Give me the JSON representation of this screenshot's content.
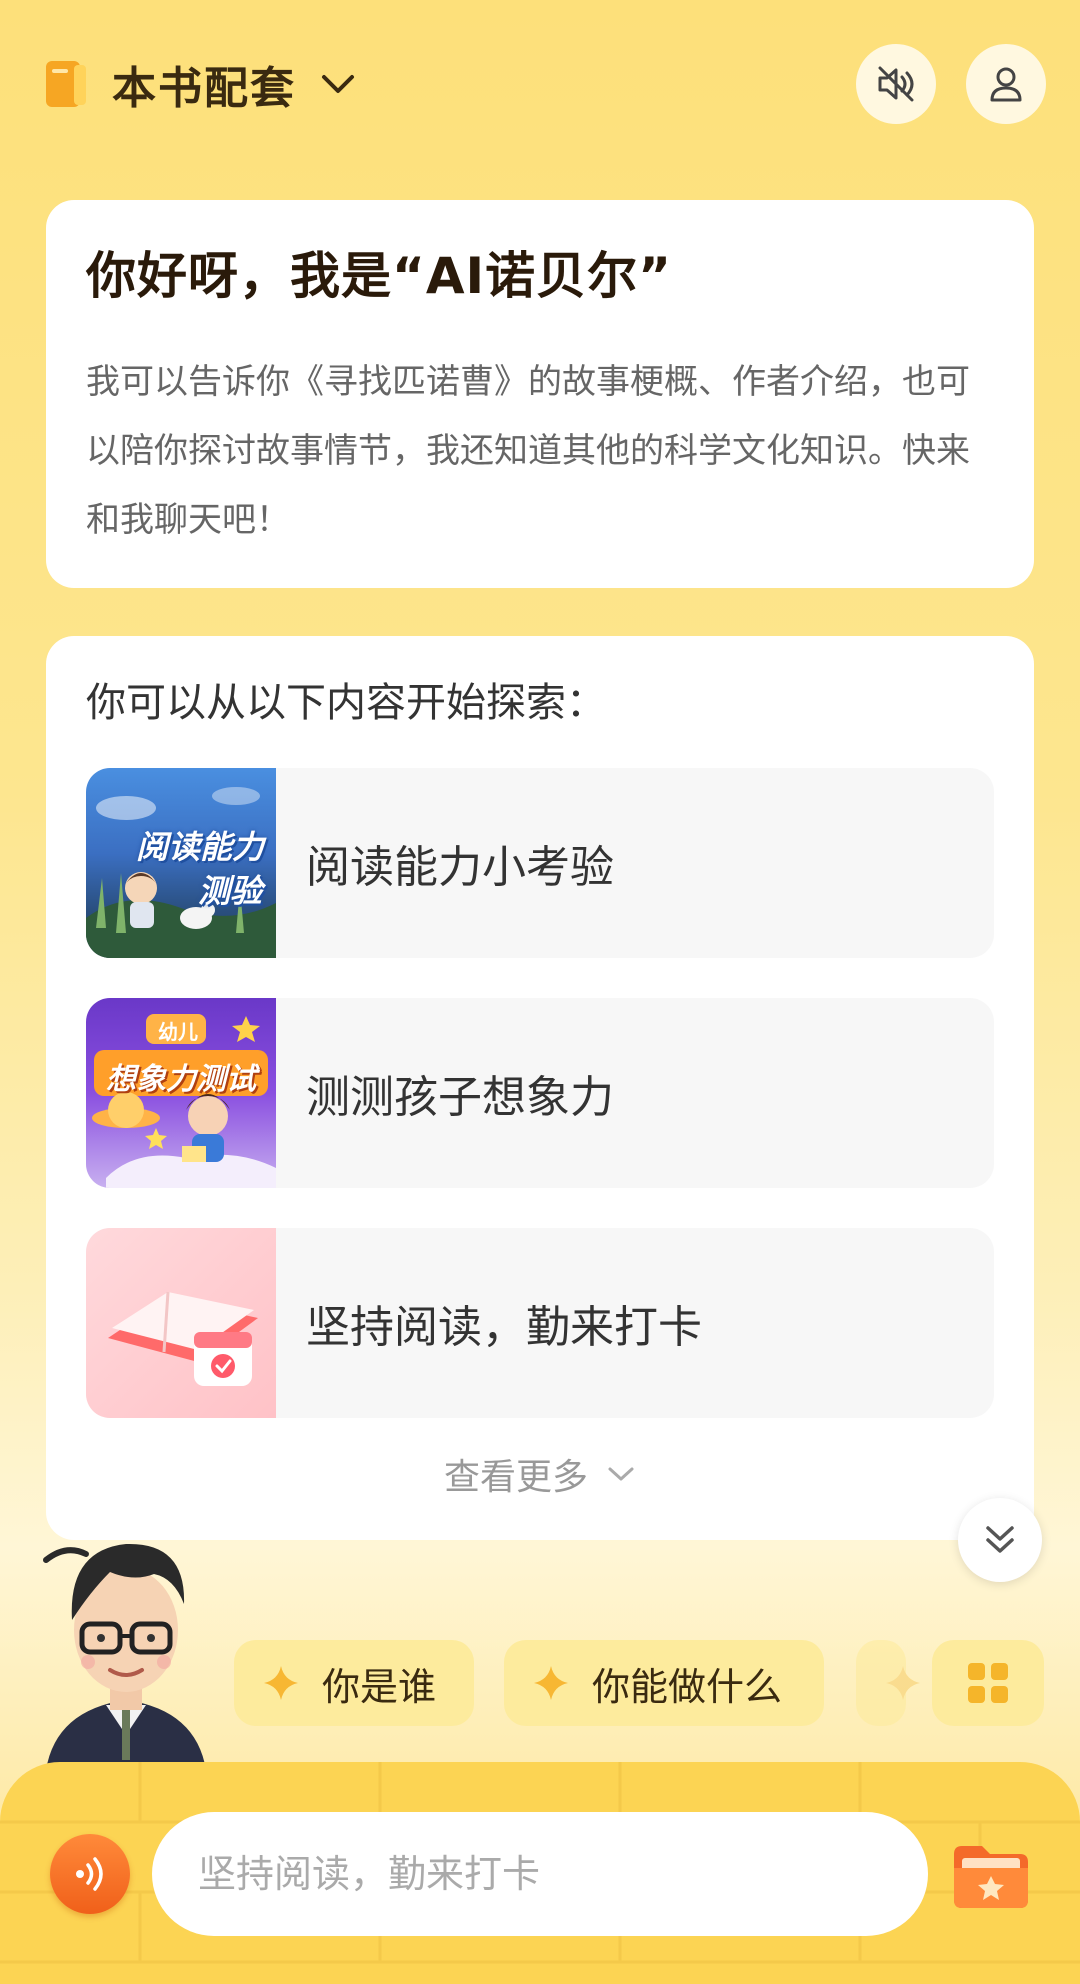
{
  "header": {
    "book_title": "本书配套",
    "icons": {
      "book": "book-icon",
      "dropdown": "chevron-down-icon",
      "mute": "speaker-mute-icon",
      "user": "user-icon"
    }
  },
  "greeting": {
    "title": "你好呀，我是“AI诺贝尔”",
    "body": "我可以告诉你《寻找匹诺曹》的故事梗概、作者介绍，也可以陪你探讨故事情节，我还知道其他的科学文化知识。快来和我聊天吧！"
  },
  "explore": {
    "heading": "你可以从以下内容开始探索：",
    "items": [
      {
        "label": "阅读能力小考验",
        "thumb_text_1": "阅读能力",
        "thumb_text_2": "测验"
      },
      {
        "label": "测测孩子想象力",
        "thumb_badge": "幼儿",
        "thumb_text": "想象力测试"
      },
      {
        "label": "坚持阅读，勤来打卡"
      }
    ],
    "more_label": "查看更多"
  },
  "suggestions": [
    {
      "label": "你是谁"
    },
    {
      "label": "你能做什么"
    }
  ],
  "input": {
    "placeholder": "坚持阅读，勤来打卡"
  },
  "colors": {
    "background": "#fde07a",
    "accent_orange": "#f0601a",
    "chip_bg": "#fdeb9d",
    "title_dark": "#2a1a0a"
  }
}
